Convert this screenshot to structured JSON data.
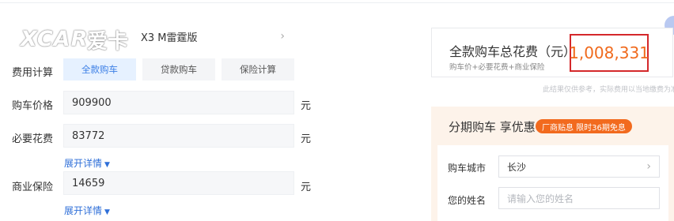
{
  "watermark": {
    "logo_text": "XCAR",
    "logo_sub": "爱卡"
  },
  "car": {
    "model": "X3 M雷霆版"
  },
  "rows": {
    "calc_label": "费用计算",
    "price_label": "购车价格",
    "fees_label": "必要花费",
    "insurance_label": "商业保险"
  },
  "tabs": [
    {
      "label": "全款购车",
      "active": true
    },
    {
      "label": "贷款购车",
      "active": false
    },
    {
      "label": "保险计算",
      "active": false
    }
  ],
  "fields": {
    "price": "909900",
    "fees": "83772",
    "insurance": "14659",
    "unit": "元"
  },
  "expand_label": "展开详情",
  "total": {
    "title": "全款购车总花费（元）",
    "subtitle": "购车价+必要花费+商业保险",
    "value": "1,008,331",
    "disclaimer": "此结果仅供参考，实际费用以当地缴费为准"
  },
  "installment": {
    "title": "分期购车 享优惠",
    "promo": "厂商贴息 限时36期免息",
    "city_label": "购车城市",
    "city_value": "长沙",
    "name_label": "您的姓名",
    "name_placeholder": "请输入您的姓名"
  },
  "colors": {
    "accent_blue": "#3c7fe6",
    "total_orange": "#f06a1d",
    "highlight_red": "#d4282b",
    "promo_orange": "#f26a1e"
  }
}
